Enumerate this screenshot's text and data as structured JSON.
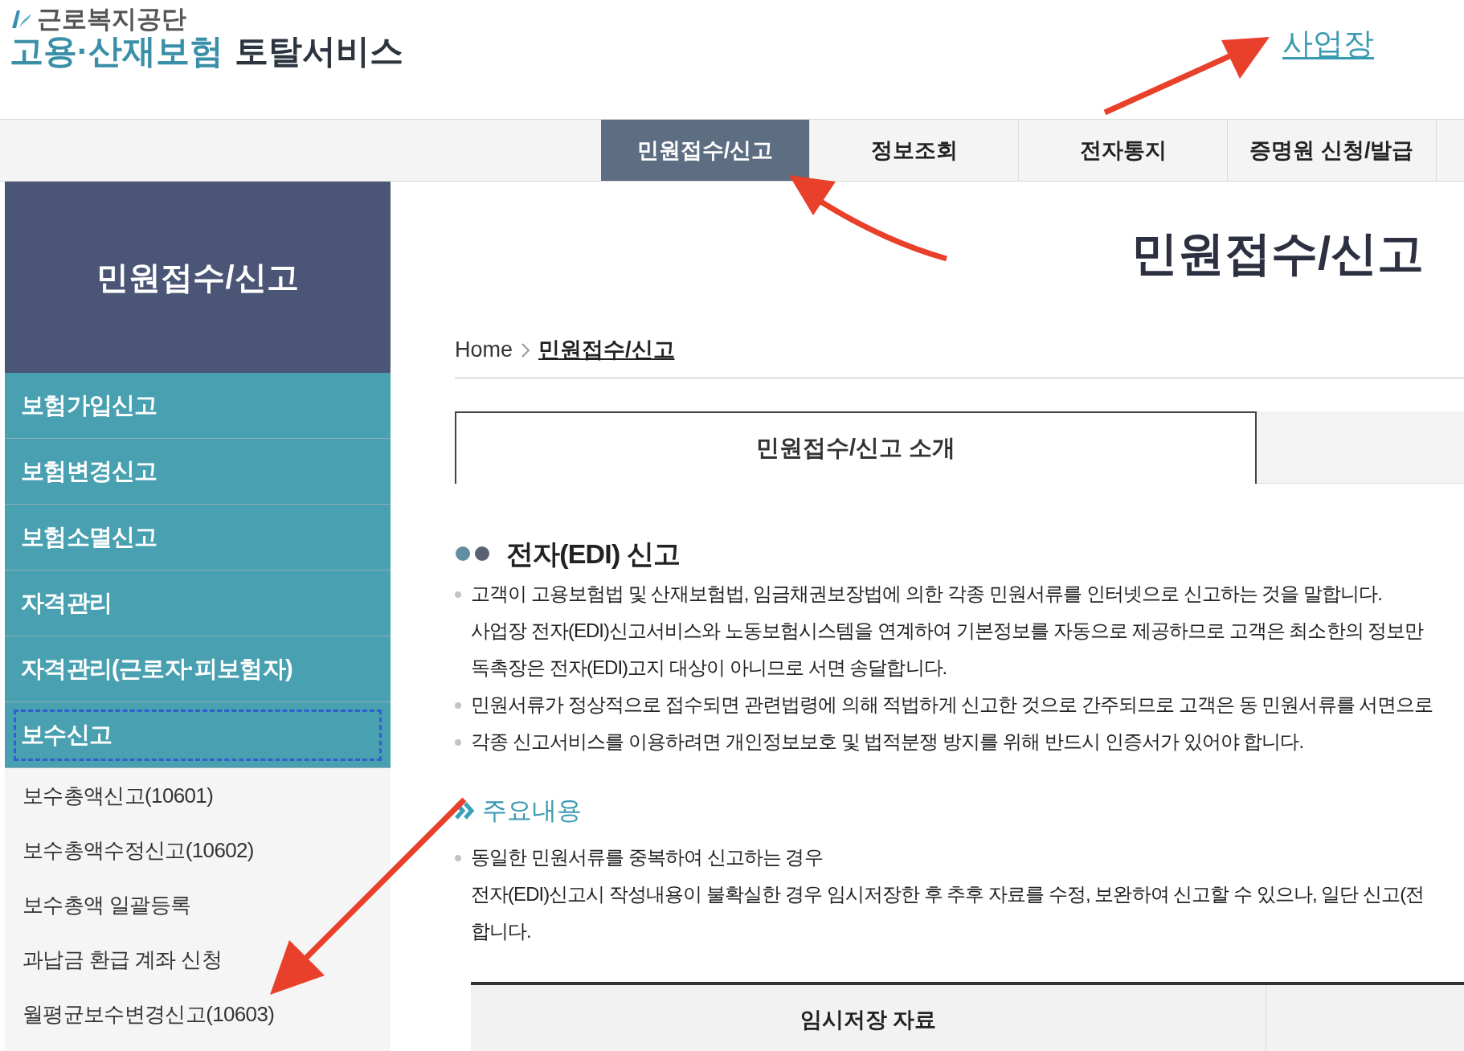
{
  "logo": {
    "org": "근로복지공단",
    "title_accent": "고용·산재보험",
    "title_main": "토탈서비스"
  },
  "top_link": "사업장",
  "nav_tabs": [
    {
      "label": "민원접수/신고",
      "selected": true
    },
    {
      "label": "정보조회",
      "selected": false
    },
    {
      "label": "전자통지",
      "selected": false
    },
    {
      "label": "증명원 신청/발급",
      "selected": false
    }
  ],
  "sidebar": {
    "title": "민원접수/신고",
    "items": [
      {
        "label": "보험가입신고",
        "focused": false
      },
      {
        "label": "보험변경신고",
        "focused": false
      },
      {
        "label": "보험소멸신고",
        "focused": false
      },
      {
        "label": "자격관리",
        "focused": false
      },
      {
        "label": "자격관리(근로자·피보험자)",
        "focused": false
      },
      {
        "label": "보수신고",
        "focused": true,
        "children": [
          {
            "label": "보수총액신고(10601)"
          },
          {
            "label": "보수총액수정신고(10602)"
          },
          {
            "label": "보수총액 일괄등록"
          },
          {
            "label": "과납금 환급 계좌 신청"
          },
          {
            "label": "월평균보수변경신고(10603)"
          }
        ]
      }
    ]
  },
  "page_title": "민원접수/신고",
  "breadcrumb": [
    "Home",
    "민원접수/신고"
  ],
  "content_tabs": [
    {
      "label": "민원접수/신고 소개",
      "selected": true
    }
  ],
  "section": {
    "heading": "전자(EDI) 신고",
    "bullets": [
      {
        "lines": [
          "고객이 고용보험법 및 산재보험법, 임금채권보장법에 의한 각종 민원서류를 인터넷으로 신고하는 것을 말합니다.",
          "사업장 전자(EDI)신고서비스와 노동보험시스템을 연계하여 기본정보를 자동으로 제공하므로 고객은 최소한의 정보만",
          "독촉장은 전자(EDI)고지 대상이 아니므로 서면 송달합니다."
        ]
      },
      {
        "lines": [
          "민원서류가 정상적으로 접수되면 관련법령에 의해 적법하게 신고한 것으로 간주되므로 고객은 동 민원서류를 서면으로"
        ]
      },
      {
        "lines": [
          "각종 신고서비스를 이용하려면 개인정보보호 및 법적분쟁 방지를 위해 반드시 인증서가 있어야 합니다."
        ]
      }
    ]
  },
  "subsection": {
    "heading": "주요내용",
    "bullets": [
      {
        "lines": [
          "동일한 민원서류를 중복하여 신고하는 경우",
          "전자(EDI)신고시 작성내용이 불확실한 경우 임시저장한 후 추후 자료를 수정, 보완하여 신고할 수 있으나, 일단 신고(전",
          "합니다."
        ]
      }
    ]
  },
  "table": {
    "columns": [
      "임시저장 자료"
    ]
  }
}
